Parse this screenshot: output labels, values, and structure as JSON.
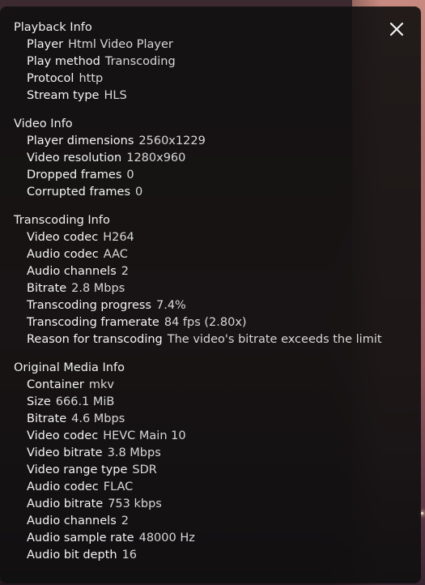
{
  "close_icon": "close-icon",
  "sections": [
    {
      "title": "Playback Info",
      "rows": [
        {
          "label": "Player",
          "value": "Html Video Player"
        },
        {
          "label": "Play method",
          "value": "Transcoding"
        },
        {
          "label": "Protocol",
          "value": "http"
        },
        {
          "label": "Stream type",
          "value": "HLS"
        }
      ]
    },
    {
      "title": "Video Info",
      "rows": [
        {
          "label": "Player dimensions",
          "value": "2560x1229"
        },
        {
          "label": "Video resolution",
          "value": "1280x960"
        },
        {
          "label": "Dropped frames",
          "value": "0"
        },
        {
          "label": "Corrupted frames",
          "value": "0"
        }
      ]
    },
    {
      "title": "Transcoding Info",
      "rows": [
        {
          "label": "Video codec",
          "value": "H264"
        },
        {
          "label": "Audio codec",
          "value": "AAC"
        },
        {
          "label": "Audio channels",
          "value": "2"
        },
        {
          "label": "Bitrate",
          "value": "2.8 Mbps"
        },
        {
          "label": "Transcoding progress",
          "value": "7.4%"
        },
        {
          "label": "Transcoding framerate",
          "value": "84 fps (2.80x)"
        },
        {
          "label": "Reason for transcoding",
          "value": "The video's bitrate exceeds the limit"
        }
      ]
    },
    {
      "title": "Original Media Info",
      "rows": [
        {
          "label": "Container",
          "value": "mkv"
        },
        {
          "label": "Size",
          "value": "666.1 MiB"
        },
        {
          "label": "Bitrate",
          "value": "4.6 Mbps"
        },
        {
          "label": "Video codec",
          "value": "HEVC Main 10"
        },
        {
          "label": "Video bitrate",
          "value": "3.8 Mbps"
        },
        {
          "label": "Video range type",
          "value": "SDR"
        },
        {
          "label": "Audio codec",
          "value": "FLAC"
        },
        {
          "label": "Audio bitrate",
          "value": "753 kbps"
        },
        {
          "label": "Audio channels",
          "value": "2"
        },
        {
          "label": "Audio sample rate",
          "value": "48000 Hz"
        },
        {
          "label": "Audio bit depth",
          "value": "16"
        }
      ]
    }
  ]
}
